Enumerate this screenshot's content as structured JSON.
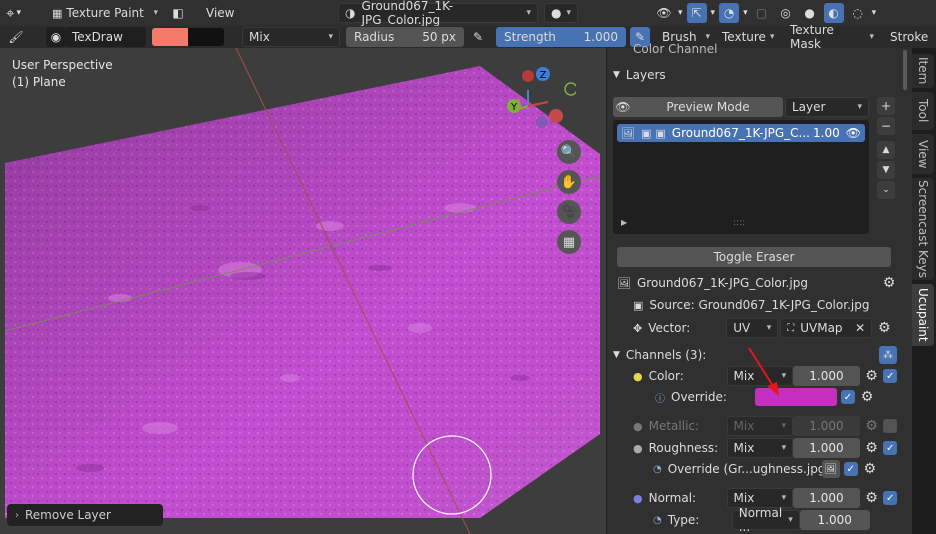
{
  "header": {
    "mode_label": "Texture Paint",
    "view_menu": "View",
    "image_name": "Ground067_1K-JPG_Color.jpg"
  },
  "tool_header": {
    "brush_name": "TexDraw",
    "color_primary": "#f47a6a",
    "color_secondary": "#111111",
    "blend_mode": "Mix",
    "radius_label": "Radius",
    "radius_value": "50 px",
    "strength_label": "Strength",
    "strength_value": "1.000",
    "strength_fill": 1.0,
    "menus": [
      "Brush",
      "Texture",
      "Texture Mask",
      "Stroke"
    ]
  },
  "viewport": {
    "perspective": "User Perspective",
    "object": "(1) Plane",
    "paint_color": "#c34ed1",
    "gizmo": {
      "x": "X",
      "y": "Y",
      "z": "Z"
    },
    "last_operator": "Remove Layer"
  },
  "panel": {
    "color_channel_heading": "Color Channel",
    "layers_heading": "Layers",
    "preview_mode": "Preview Mode",
    "layer_dropdown": "Layer",
    "layer_item_name": "Ground067_1K-JPG_C...",
    "layer_item_opacity": "1.00",
    "resize_handle": "::::",
    "toggle_eraser": "Toggle Eraser",
    "image_title": "Ground067_1K-JPG_Color.jpg",
    "source_label": "Source: Ground067_1K-JPG_Color.jpg",
    "vector_label": "Vector:",
    "vector_mode": "UV",
    "uvmap_name": "UVMap",
    "channels_heading": "Channels (3):",
    "channels": {
      "color": {
        "label": "Color:",
        "blend": "Mix",
        "value": "1.000"
      },
      "override_label": "Override:",
      "override_color": "#c42fbf",
      "metallic": {
        "label": "Metallic:",
        "blend": "Mix",
        "value": "1.000"
      },
      "roughness": {
        "label": "Roughness:",
        "blend": "Mix",
        "value": "1.000"
      },
      "roughness_override_label": "Override (Gr...ughness.jpg):",
      "normal": {
        "label": "Normal:",
        "blend": "Mix",
        "value": "1.000"
      },
      "type_label": "Type:",
      "type_value": "Normal ...",
      "type_strength": "1.000"
    }
  },
  "side_tabs": [
    "Item",
    "Tool",
    "View",
    "Screencast Keys",
    "Ucupaint"
  ],
  "annotation_color": "#e8141c"
}
